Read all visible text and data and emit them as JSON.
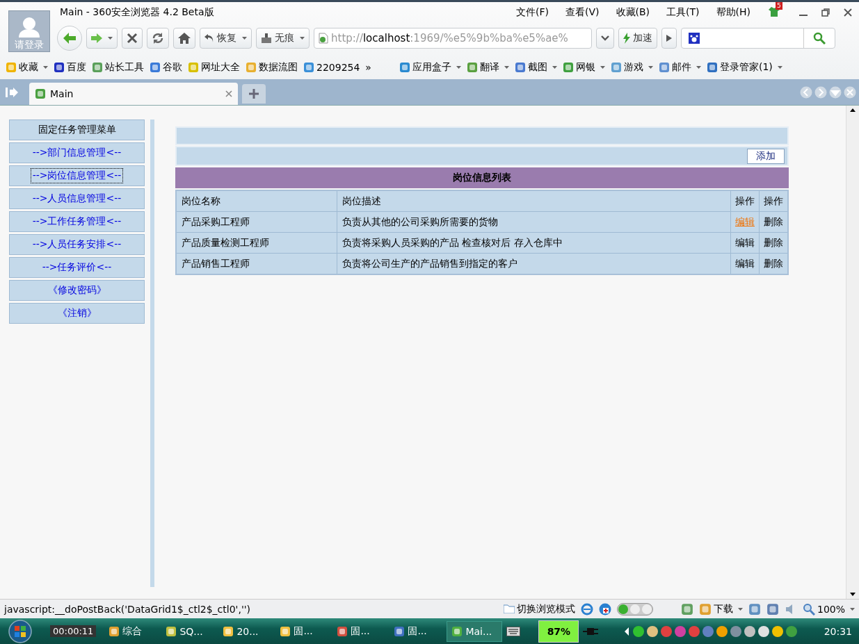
{
  "window": {
    "title": "Main - 360安全浏览器 4.2 Beta版",
    "avatar_label": "请登录",
    "menu": [
      "文件(F)",
      "查看(V)",
      "收藏(B)",
      "工具(T)",
      "帮助(H)"
    ],
    "notify_badge": "5"
  },
  "toolbar": {
    "restore": "恢复",
    "incognito": "无痕",
    "address": "http://localhost:1969/%e5%9b%ba%e5%ae%",
    "speedup": "加速"
  },
  "bookmarks": [
    {
      "label": "收藏",
      "dropdown": true
    },
    {
      "label": "百度",
      "dropdown": false
    },
    {
      "label": "站长工具",
      "dropdown": false
    },
    {
      "label": "谷歌",
      "dropdown": false
    },
    {
      "label": "网址大全",
      "dropdown": false
    },
    {
      "label": "数据流图",
      "dropdown": false
    },
    {
      "label": "2209254",
      "dropdown": false
    }
  ],
  "bookmarks_more": "»",
  "apps": [
    {
      "label": "应用盒子",
      "dropdown": true
    },
    {
      "label": "翻译",
      "dropdown": true
    },
    {
      "label": "截图",
      "dropdown": true
    },
    {
      "label": "网银",
      "dropdown": true
    },
    {
      "label": "游戏",
      "dropdown": true
    },
    {
      "label": "邮件",
      "dropdown": true
    },
    {
      "label": "登录管家(1)",
      "dropdown": true
    }
  ],
  "tabs": [
    {
      "label": "Main",
      "selected": true
    }
  ],
  "sidebar": {
    "title": "固定任务管理菜单",
    "items": [
      {
        "label": "-->部门信息管理<--",
        "selected": false
      },
      {
        "label": "-->岗位信息管理<--",
        "selected": true
      },
      {
        "label": "-->人员信息管理<--",
        "selected": false
      },
      {
        "label": "-->工作任务管理<--",
        "selected": false
      },
      {
        "label": "-->人员任务安排<--",
        "selected": false
      },
      {
        "label": "-->任务评价<--",
        "selected": false
      },
      {
        "label": "《修改密码》",
        "selected": false
      },
      {
        "label": "《注销》",
        "selected": false
      }
    ]
  },
  "panel": {
    "add_button": "添加",
    "title": "岗位信息列表"
  },
  "table": {
    "columns": [
      "岗位名称",
      "岗位描述",
      "操作",
      "操作"
    ],
    "rows": [
      {
        "name": "产品采购工程师",
        "description": "负责从其他的公司采购所需要的货物",
        "edit": "编辑",
        "delete": "删除",
        "hovered": true
      },
      {
        "name": "产品质量检测工程师",
        "description": "负责将采购人员采购的产品  检查核对后  存入仓库中",
        "edit": "编辑",
        "delete": "删除",
        "hovered": false
      },
      {
        "name": "产品销售工程师",
        "description": "负责将公司生产的产品销售到指定的客户",
        "edit": "编辑",
        "delete": "删除",
        "hovered": false
      }
    ]
  },
  "status_bar": {
    "text": "javascript:__doPostBack('DataGrid1$_ctl2$_ctl0','')",
    "mode": "切换浏览模式",
    "download": "下载",
    "zoom": "100%"
  },
  "taskbar": {
    "recorder_time": "00:00:11",
    "items": [
      {
        "label": "综合",
        "selected": false
      },
      {
        "label": "SQ...",
        "selected": false
      },
      {
        "label": "20...",
        "selected": false
      },
      {
        "label": "固...",
        "selected": false
      },
      {
        "label": "固...",
        "selected": false
      },
      {
        "label": "固...",
        "selected": false
      },
      {
        "label": "Mai...",
        "selected": true
      }
    ],
    "battery": "87%",
    "clock": "20:31"
  }
}
